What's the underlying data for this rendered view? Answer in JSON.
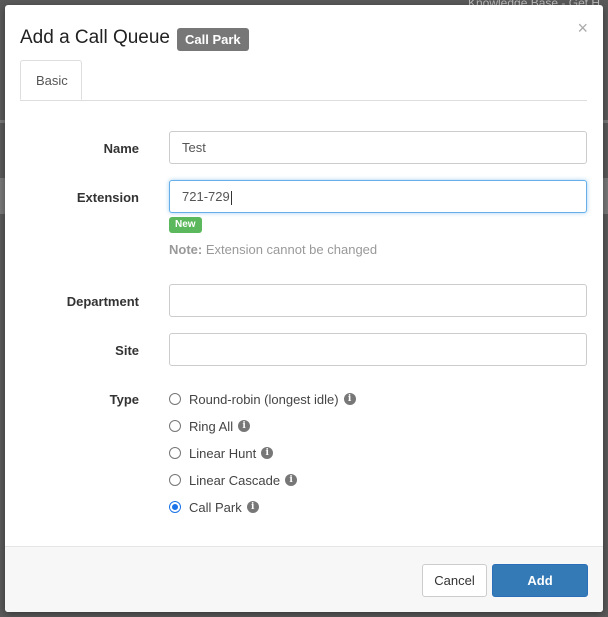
{
  "background": {
    "top_right_text": "Knowledge Base - Get H"
  },
  "dialog": {
    "title": "Add a Call Queue",
    "badge": "Call Park",
    "close_glyph": "×",
    "tabs": [
      {
        "label": "Basic",
        "active": true
      }
    ]
  },
  "form": {
    "name": {
      "label": "Name",
      "value": "Test"
    },
    "extension": {
      "label": "Extension",
      "value": "721-729",
      "badge": "New",
      "note_bold": "Note:",
      "note_text": " Extension cannot be changed"
    },
    "department": {
      "label": "Department",
      "value": ""
    },
    "site": {
      "label": "Site",
      "value": ""
    },
    "type": {
      "label": "Type",
      "options": [
        {
          "label": "Round-robin (longest idle)",
          "checked": false
        },
        {
          "label": "Ring All",
          "checked": false
        },
        {
          "label": "Linear Hunt",
          "checked": false
        },
        {
          "label": "Linear Cascade",
          "checked": false
        },
        {
          "label": "Call Park",
          "checked": true
        }
      ],
      "info_glyph": "i"
    }
  },
  "footer": {
    "cancel_label": "Cancel",
    "add_label": "Add"
  },
  "colors": {
    "primary": "#337ab7",
    "new_badge": "#5cb85c",
    "title_badge": "#777777",
    "focus": "#66afe9"
  }
}
